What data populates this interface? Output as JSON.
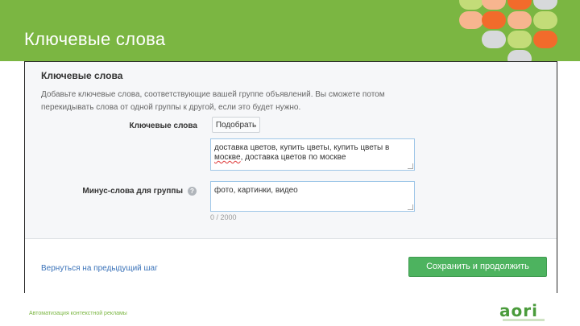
{
  "slide": {
    "title": "Ключевые слова",
    "footer_text": "Автоматизация контекстной рекламы",
    "logo_text": "aori",
    "colors": {
      "header_bg": "#7bb642",
      "accent_orange": "#f26b2b",
      "accent_light_orange": "#f7b58f",
      "accent_lime": "#c3dc78",
      "accent_gray": "#d7d9db"
    },
    "dots": [
      {
        "color": "#c3dc78"
      },
      {
        "color": "#f7b58f"
      },
      {
        "color": "#f26b2b"
      },
      {
        "color": "#d7d9db"
      },
      {
        "color": "#f7b58f"
      },
      {
        "color": "#f26b2b"
      },
      {
        "color": "#f7b58f"
      },
      {
        "color": "#c3dc78"
      },
      {
        "color": "#d7d9db"
      },
      {
        "color": "#f26b2b"
      },
      {
        "color": "#c3dc78"
      },
      {
        "color": "#d7d9db"
      }
    ]
  },
  "panel": {
    "heading": "Ключевые слова",
    "description": "Добавьте ключевые слова, соответствующие вашей группе объявлений. Вы сможете потом перекидывать слова от одной группы к другой, если это будет нужно.",
    "keywords_label": "Ключевые слова",
    "pick_button": "Подобрать",
    "keywords_value_line1": "доставка цветов, купить цветы, купить цветы в",
    "keywords_value_misspelled": "москве",
    "keywords_value_line2_rest": ", доставка цветов по москве",
    "minus_label": "Минус-слова для группы",
    "help_icon": "question-circle-icon",
    "minus_value": "фото, картинки, видео",
    "counter": "0 / 2000",
    "back_link": "Вернуться на предыдущий шаг",
    "save_button": "Сохранить и продолжить"
  }
}
